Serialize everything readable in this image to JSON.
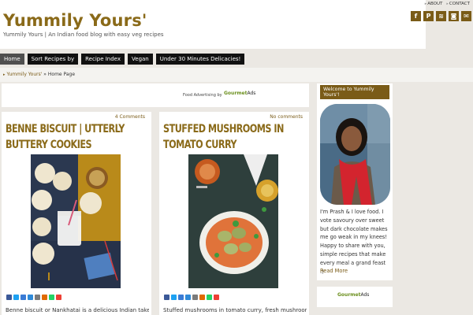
{
  "header": {
    "title": "Yummily Yours'",
    "tagline": "Yummily Yours | An Indian food blog with easy veg recipes",
    "top_links": [
      "ABOUT",
      "CONTACT"
    ],
    "social_icons": [
      {
        "name": "facebook-icon",
        "glyph": "f"
      },
      {
        "name": "pinterest-icon",
        "glyph": "P"
      },
      {
        "name": "rss-icon",
        "glyph": "≋"
      },
      {
        "name": "instagram-icon",
        "glyph": "◙"
      },
      {
        "name": "email-icon",
        "glyph": "✉"
      }
    ]
  },
  "nav": {
    "items": [
      "Home",
      "Sort Recipes by",
      "Recipe Index",
      "Vegan",
      "Under 30 Minutes Delicacies!"
    ]
  },
  "breadcrumb": {
    "home": "Yummily Yours'",
    "sep": "»",
    "current": "Home Page"
  },
  "ad": {
    "label": "Food Advertising by",
    "brand_prefix": "Gourmet",
    "brand_suffix": "Ads"
  },
  "posts": [
    {
      "comments": "4 Comments",
      "title": "Benne Biscuit | Utterly Buttery Cookies",
      "excerpt": "Benne biscuit or Nankhatai is a delicious Indian take on"
    },
    {
      "comments": "No comments",
      "title": "Stuffed Mushrooms in Tomato Curry",
      "excerpt": "Stuffed mushrooms in tomato curry, fresh mushrooms"
    }
  ],
  "sidebar": {
    "welcome_title": "Welcome to Yummily Yours'!",
    "bio": "I'm Prash & I love food. I vote savoury over sweet but dark chocolate makes me go weak in my knees! Happy to share with you, simple recipes that make every meal a grand feast :)",
    "read_more": "Read More",
    "ad_brand_prefix": "Gourmet",
    "ad_brand_suffix": "Ads"
  },
  "colors": {
    "brand": "#8a6a19",
    "nav_bg": "#111111",
    "page_bg": "#ebe8e3"
  }
}
